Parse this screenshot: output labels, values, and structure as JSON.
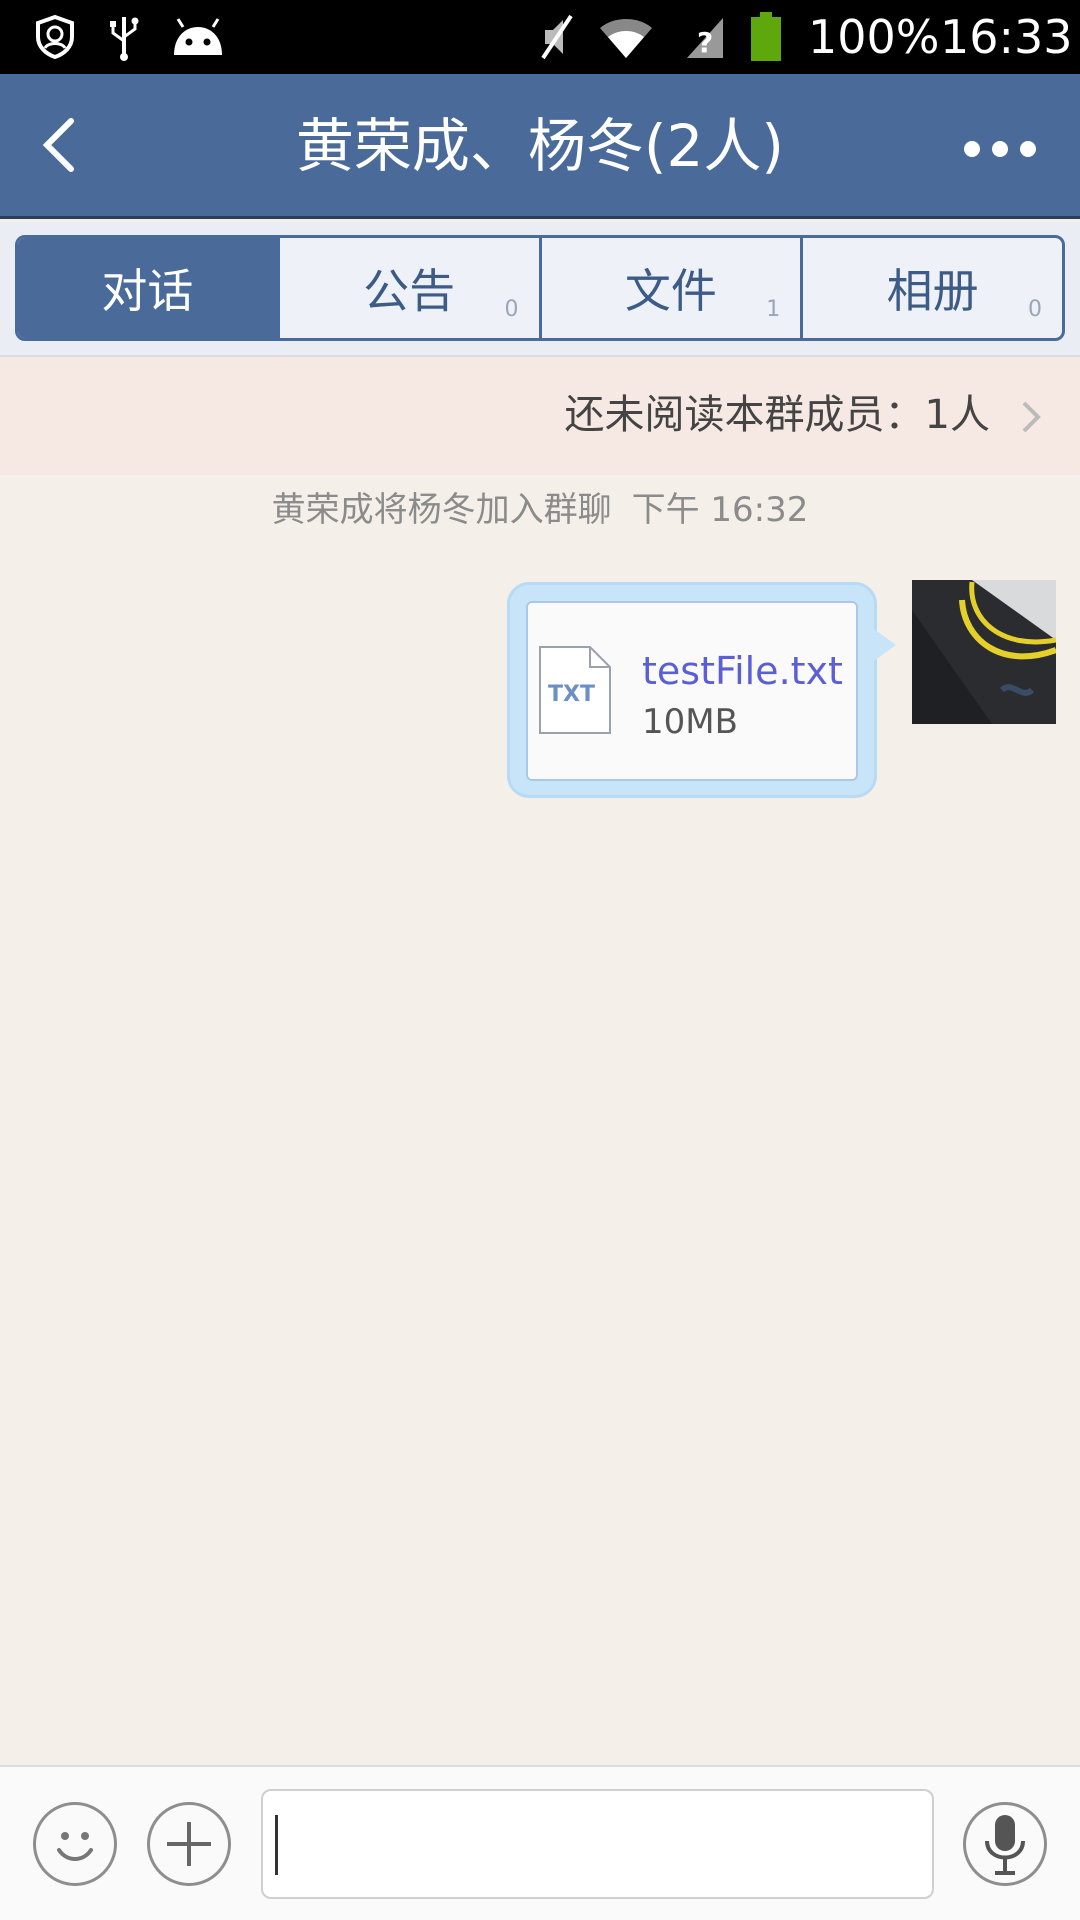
{
  "status_bar": {
    "battery_percent": "100%",
    "time": "16:33",
    "icons": [
      "shield-icon",
      "usb-icon",
      "android-icon",
      "mute-icon",
      "wifi-icon",
      "no-sim-icon",
      "battery-icon"
    ],
    "battery_color": "#5ea80e"
  },
  "header": {
    "title": "黄荣成、杨冬(2人)",
    "back_icon": "back-arrow-icon",
    "more_icon": "more-dots-icon",
    "color": "#4a6b9a"
  },
  "tabs": [
    {
      "label": "对话",
      "count": "",
      "active": true
    },
    {
      "label": "公告",
      "count": "0",
      "active": false
    },
    {
      "label": "文件",
      "count": "1",
      "active": false
    },
    {
      "label": "相册",
      "count": "0",
      "active": false
    }
  ],
  "unread_banner": {
    "text": "还未阅读本群成员：1人",
    "chevron_icon": "chevron-right-icon"
  },
  "system_message": {
    "text": "黄荣成将杨冬加入群聊",
    "time": "下午 16:32"
  },
  "message": {
    "file_type_label": "TXT",
    "file_name": "testFile.txt",
    "file_size": "10MB"
  },
  "input_bar": {
    "emoji_icon": "emoji-icon",
    "plus_icon": "plus-icon",
    "mic_icon": "microphone-icon",
    "input_value": ""
  }
}
